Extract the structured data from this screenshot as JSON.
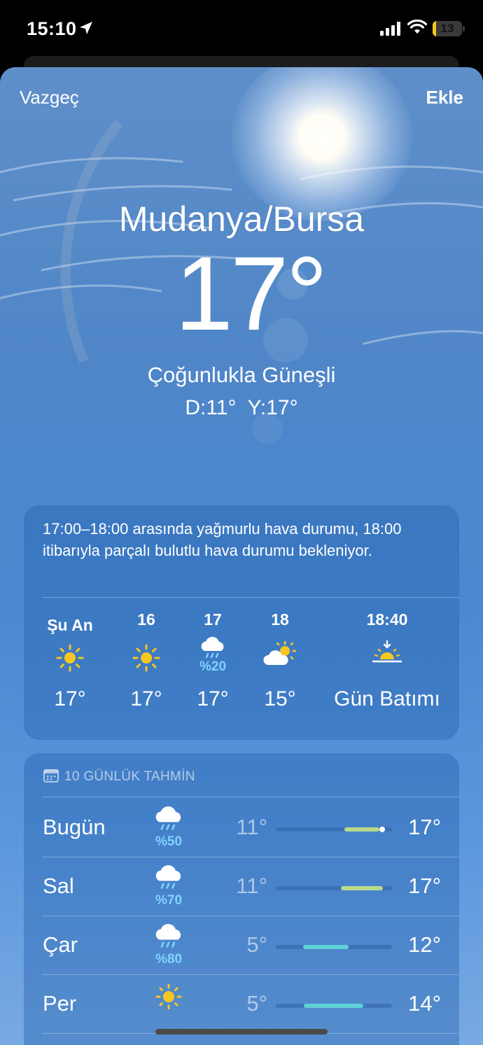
{
  "status_bar": {
    "time": "15:10",
    "battery": "13",
    "battery_level": 0.13
  },
  "nav": {
    "cancel": "Vazgeç",
    "add": "Ekle"
  },
  "current": {
    "city": "Mudanya/Bursa",
    "temperature": "17°",
    "condition": "Çoğunlukla Güneşli",
    "low": "D:11°",
    "high": "Y:17°"
  },
  "hourly": {
    "summary": "17:00–18:00 arasında yağmurlu hava durumu, 18:00 itibarıyla parçalı bulutlu hava durumu bekleniyor.",
    "items": [
      {
        "label": "Şu An",
        "icon": "sun-icon",
        "precip": "",
        "temp": "17°"
      },
      {
        "label": "16",
        "icon": "sun-icon",
        "precip": "",
        "temp": "17°"
      },
      {
        "label": "17",
        "icon": "rain-cloud-icon",
        "precip": "%20",
        "temp": "17°"
      },
      {
        "label": "18",
        "icon": "partly-cloudy-icon",
        "precip": "",
        "temp": "15°"
      },
      {
        "label": "18:40",
        "icon": "sunset-icon",
        "precip": "",
        "temp": "Gün Batımı"
      }
    ]
  },
  "daily": {
    "header": "10 GÜNLÜK TAHMİN",
    "rows": [
      {
        "day": "Bugün",
        "icon": "rain-cloud-icon",
        "precip": "%50",
        "low": "11°",
        "high": "17°"
      },
      {
        "day": "Sal",
        "icon": "rain-cloud-icon",
        "precip": "%70",
        "low": "11°",
        "high": "17°"
      },
      {
        "day": "Çar",
        "icon": "rain-cloud-icon",
        "precip": "%80",
        "low": "5°",
        "high": "12°"
      },
      {
        "day": "Per",
        "icon": "sun-icon",
        "precip": "",
        "low": "5°",
        "high": "14°"
      }
    ]
  },
  "colors": {
    "sun": "#f8c620",
    "precip": "#7fd3ff",
    "range_warm": "#b9d98a",
    "range_cool": "#5fd2d8"
  }
}
